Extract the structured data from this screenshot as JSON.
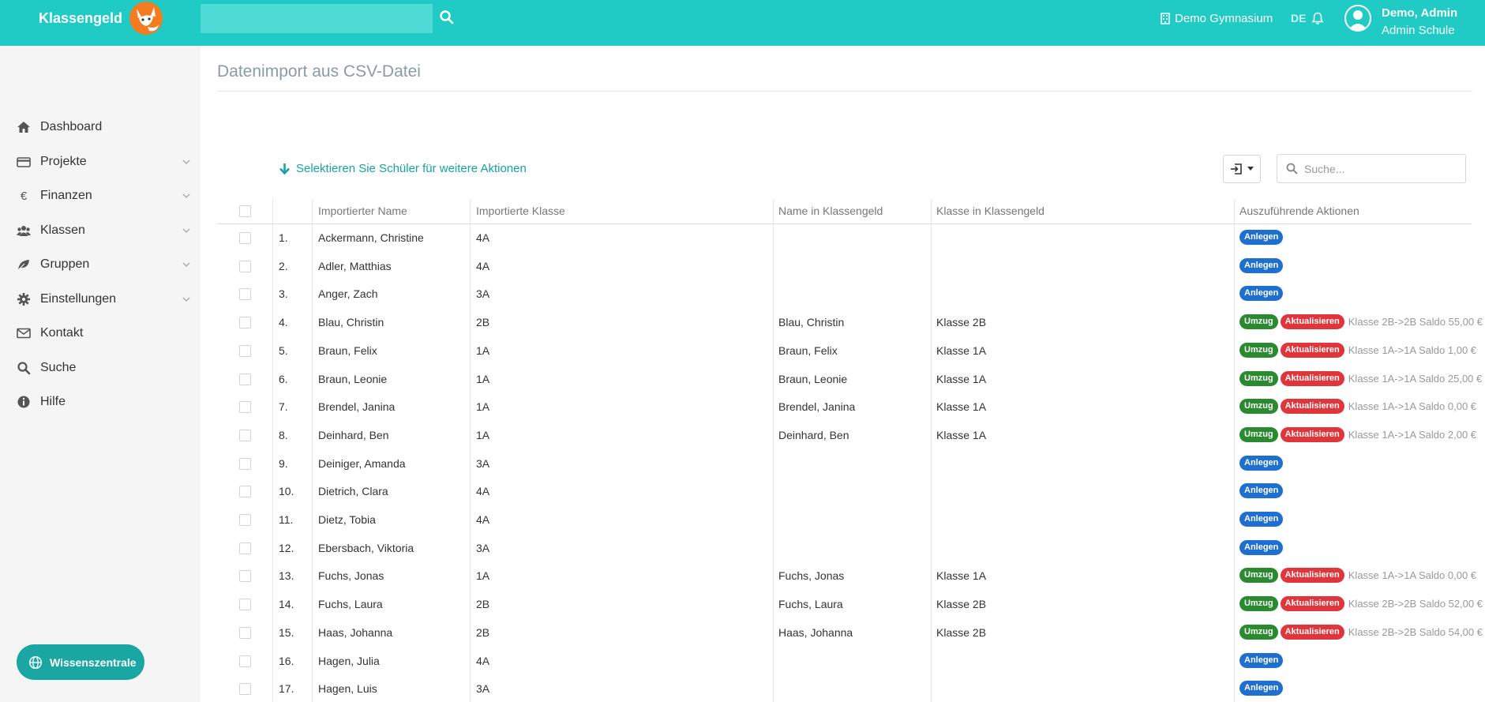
{
  "topbar": {
    "brand": "Klassengeld",
    "search_value": "",
    "school": "Demo Gymnasium",
    "lang": "DE",
    "user_name": "Demo, Admin",
    "user_role": "Admin Schule"
  },
  "sidebar": {
    "items": [
      {
        "label": "Dashboard",
        "icon": "home-icon",
        "chevron": false
      },
      {
        "label": "Projekte",
        "icon": "credit-card-icon",
        "chevron": true
      },
      {
        "label": "Finanzen",
        "icon": "euro-icon",
        "chevron": true
      },
      {
        "label": "Klassen",
        "icon": "users-icon",
        "chevron": true
      },
      {
        "label": "Gruppen",
        "icon": "leaf-icon",
        "chevron": true
      },
      {
        "label": "Einstellungen",
        "icon": "gear-icon",
        "chevron": true
      },
      {
        "label": "Kontakt",
        "icon": "envelope-icon",
        "chevron": false
      },
      {
        "label": "Suche",
        "icon": "search-icon",
        "chevron": false
      },
      {
        "label": "Hilfe",
        "icon": "info-icon",
        "chevron": false
      }
    ],
    "help_button": "Wissenszentrale"
  },
  "main": {
    "title": "Datenimport aus CSV-Datei",
    "select_hint": "Selektieren Sie Schüler für weitere Aktionen",
    "search_placeholder": "Suche...",
    "columns": {
      "imported_name": "Importierter Name",
      "imported_class": "Importierte Klasse",
      "name_kg": "Name in Klassengeld",
      "class_kg": "Klasse in Klassengeld",
      "actions": "Auszuführende Aktionen"
    },
    "badges": {
      "anlegen": "Anlegen",
      "umzug": "Umzug",
      "aktualisieren": "Aktualisieren"
    },
    "rows": [
      {
        "nr": "1.",
        "name": "Ackermann, Christine",
        "klasse": "4A",
        "kg_name": "",
        "kg_klasse": "",
        "actions": [
          "anlegen"
        ],
        "note": ""
      },
      {
        "nr": "2.",
        "name": "Adler, Matthias",
        "klasse": "4A",
        "kg_name": "",
        "kg_klasse": "",
        "actions": [
          "anlegen"
        ],
        "note": ""
      },
      {
        "nr": "3.",
        "name": "Anger, Zach",
        "klasse": "3A",
        "kg_name": "",
        "kg_klasse": "",
        "actions": [
          "anlegen"
        ],
        "note": ""
      },
      {
        "nr": "4.",
        "name": "Blau, Christin",
        "klasse": "2B",
        "kg_name": "Blau, Christin",
        "kg_klasse": "Klasse 2B",
        "actions": [
          "umzug",
          "aktualisieren"
        ],
        "note": "Klasse 2B->2B Saldo 55,00 €"
      },
      {
        "nr": "5.",
        "name": "Braun, Felix",
        "klasse": "1A",
        "kg_name": "Braun, Felix",
        "kg_klasse": "Klasse 1A",
        "actions": [
          "umzug",
          "aktualisieren"
        ],
        "note": "Klasse 1A->1A Saldo 1,00 €"
      },
      {
        "nr": "6.",
        "name": "Braun, Leonie",
        "klasse": "1A",
        "kg_name": "Braun, Leonie",
        "kg_klasse": "Klasse 1A",
        "actions": [
          "umzug",
          "aktualisieren"
        ],
        "note": "Klasse 1A->1A Saldo 25,00 €"
      },
      {
        "nr": "7.",
        "name": "Brendel, Janina",
        "klasse": "1A",
        "kg_name": "Brendel, Janina",
        "kg_klasse": "Klasse 1A",
        "actions": [
          "umzug",
          "aktualisieren"
        ],
        "note": "Klasse 1A->1A Saldo 0,00 €"
      },
      {
        "nr": "8.",
        "name": "Deinhard, Ben",
        "klasse": "1A",
        "kg_name": "Deinhard, Ben",
        "kg_klasse": "Klasse 1A",
        "actions": [
          "umzug",
          "aktualisieren"
        ],
        "note": "Klasse 1A->1A Saldo 2,00 €"
      },
      {
        "nr": "9.",
        "name": "Deiniger, Amanda",
        "klasse": "3A",
        "kg_name": "",
        "kg_klasse": "",
        "actions": [
          "anlegen"
        ],
        "note": ""
      },
      {
        "nr": "10.",
        "name": "Dietrich, Clara",
        "klasse": "4A",
        "kg_name": "",
        "kg_klasse": "",
        "actions": [
          "anlegen"
        ],
        "note": ""
      },
      {
        "nr": "11.",
        "name": "Dietz, Tobia",
        "klasse": "4A",
        "kg_name": "",
        "kg_klasse": "",
        "actions": [
          "anlegen"
        ],
        "note": ""
      },
      {
        "nr": "12.",
        "name": "Ebersbach, Viktoria",
        "klasse": "3A",
        "kg_name": "",
        "kg_klasse": "",
        "actions": [
          "anlegen"
        ],
        "note": ""
      },
      {
        "nr": "13.",
        "name": "Fuchs, Jonas",
        "klasse": "1A",
        "kg_name": "Fuchs, Jonas",
        "kg_klasse": "Klasse 1A",
        "actions": [
          "umzug",
          "aktualisieren"
        ],
        "note": "Klasse 1A->1A Saldo 0,00 €"
      },
      {
        "nr": "14.",
        "name": "Fuchs, Laura",
        "klasse": "2B",
        "kg_name": "Fuchs, Laura",
        "kg_klasse": "Klasse 2B",
        "actions": [
          "umzug",
          "aktualisieren"
        ],
        "note": "Klasse 2B->2B Saldo 52,00 €"
      },
      {
        "nr": "15.",
        "name": "Haas, Johanna",
        "klasse": "2B",
        "kg_name": "Haas, Johanna",
        "kg_klasse": "Klasse 2B",
        "actions": [
          "umzug",
          "aktualisieren"
        ],
        "note": "Klasse 2B->2B Saldo 54,00 €"
      },
      {
        "nr": "16.",
        "name": "Hagen, Julia",
        "klasse": "4A",
        "kg_name": "",
        "kg_klasse": "",
        "actions": [
          "anlegen"
        ],
        "note": ""
      },
      {
        "nr": "17.",
        "name": "Hagen, Luis",
        "klasse": "3A",
        "kg_name": "",
        "kg_klasse": "",
        "actions": [
          "anlegen"
        ],
        "note": ""
      }
    ]
  },
  "colors": {
    "topbar": "#20cbc6",
    "accent": "#17a4a1",
    "badge_anlegen": "#1e6fd0",
    "badge_umzug": "#2a8a2f",
    "badge_aktualisieren": "#e0353b"
  }
}
